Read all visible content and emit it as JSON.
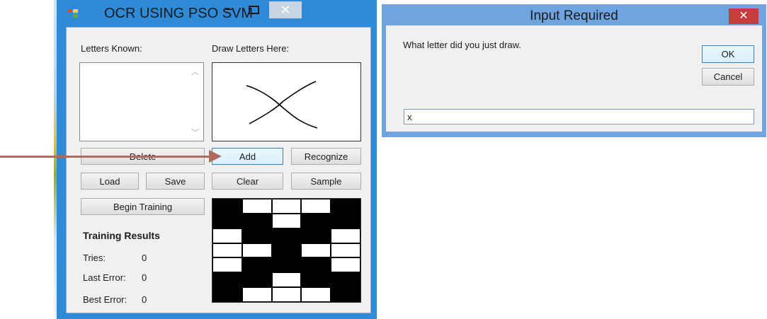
{
  "main_window": {
    "title": "OCR USING PSO SVM",
    "controls": {
      "minimize": "–",
      "close": "✕"
    }
  },
  "letters_known_label": "Letters Known:",
  "draw_label": "Draw Letters Here:",
  "buttons": {
    "delete": "Delete",
    "add": "Add",
    "recognize": "Recognize",
    "load": "Load",
    "save": "Save",
    "clear": "Clear",
    "sample": "Sample",
    "begin_training": "Begin Training"
  },
  "training_results": {
    "title": "Training Results",
    "tries_label": "Tries:",
    "tries_value": "0",
    "last_error_label": "Last Error:",
    "last_error_value": "0",
    "best_error_label": "Best Error:",
    "best_error_value": "0"
  },
  "sample_grid": {
    "cols": 5,
    "rows": 7,
    "cells": [
      [
        1,
        0,
        0,
        0,
        1
      ],
      [
        1,
        1,
        0,
        1,
        1
      ],
      [
        0,
        1,
        1,
        1,
        0
      ],
      [
        0,
        0,
        1,
        0,
        0
      ],
      [
        0,
        1,
        1,
        1,
        0
      ],
      [
        1,
        1,
        0,
        1,
        1
      ],
      [
        1,
        0,
        0,
        0,
        1
      ]
    ]
  },
  "dialog": {
    "title": "Input Required",
    "close": "✕",
    "message": "What letter did you just draw.",
    "ok": "OK",
    "cancel": "Cancel",
    "input_value": "x"
  }
}
